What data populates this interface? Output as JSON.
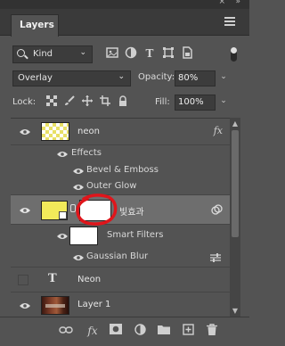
{
  "panel": {
    "tab_label": "Layers",
    "close_glyph": "×",
    "collapse_glyph": "»"
  },
  "filter": {
    "kind_label": "Kind",
    "icons": [
      "pixel-layer-filter-icon",
      "adjustment-layer-filter-icon",
      "type-layer-filter-icon",
      "shape-layer-filter-icon",
      "smart-object-filter-icon"
    ]
  },
  "blend": {
    "mode": "Overlay",
    "opacity_label": "Opacity:",
    "opacity_value": "80%",
    "lock_label": "Lock:",
    "fill_label": "Fill:",
    "fill_value": "100%"
  },
  "layers": {
    "neon_fx": {
      "name": "neon",
      "fx": "fx",
      "effects_label": "Effects",
      "effect_1": "Bevel & Emboss",
      "effect_2": "Outer Glow"
    },
    "smart": {
      "name": "빛효과",
      "smart_filters_label": "Smart Filters",
      "filter_1": "Gaussian Blur"
    },
    "text_layer": {
      "type_glyph": "T",
      "name": "Neon"
    },
    "layer1": {
      "name": "Layer 1"
    }
  },
  "colors": {
    "panel_bg": "#535353",
    "selected_row": "#6e6e6e",
    "annotation_red": "#e0151b",
    "thumb_yellow": "#f2ea5a"
  }
}
